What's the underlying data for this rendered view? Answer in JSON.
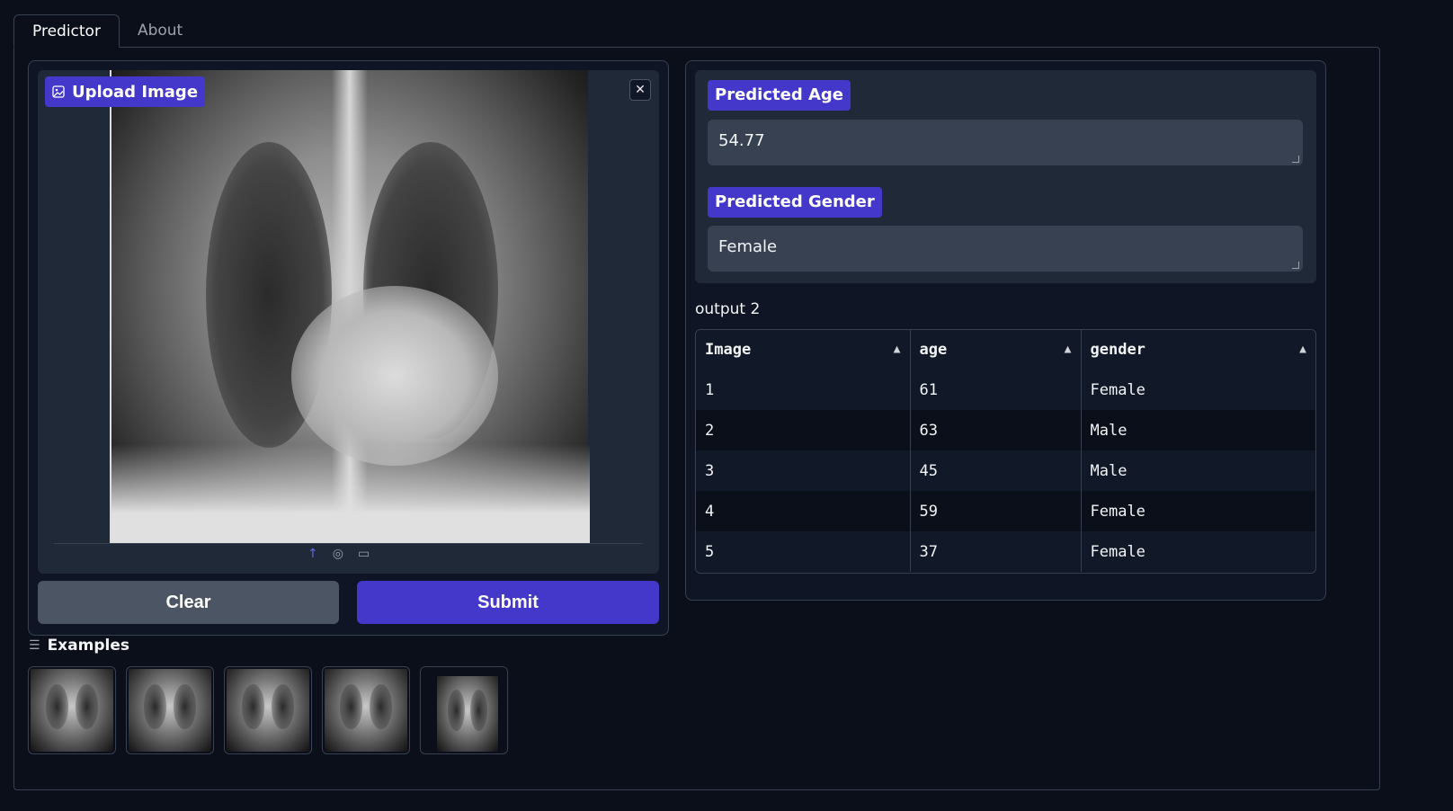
{
  "tabs": [
    {
      "label": "Predictor",
      "active": true
    },
    {
      "label": "About",
      "active": false
    }
  ],
  "input": {
    "upload_label": "Upload Image",
    "close_icon": "close-icon",
    "source_icons": [
      "upload-icon",
      "webcam-icon",
      "clipboard-icon"
    ]
  },
  "buttons": {
    "clear": "Clear",
    "submit": "Submit"
  },
  "examples": {
    "title": "Examples",
    "items": [
      "example-1",
      "example-2",
      "example-3",
      "example-4",
      "example-5"
    ]
  },
  "outputs": {
    "age_label": "Predicted Age",
    "age_value": "54.77",
    "gender_label": "Predicted Gender",
    "gender_value": "Female"
  },
  "table": {
    "label": "output 2",
    "headers": [
      "Image",
      "age",
      "gender"
    ],
    "rows": [
      [
        "1",
        "61",
        "Female"
      ],
      [
        "2",
        "63",
        "Male"
      ],
      [
        "3",
        "45",
        "Male"
      ],
      [
        "4",
        "59",
        "Female"
      ],
      [
        "5",
        "37",
        "Female"
      ]
    ]
  },
  "colors": {
    "accent": "#4338ca",
    "background": "#0b0f19",
    "panel": "#1f2937",
    "secondary_button": "#4b5563"
  }
}
